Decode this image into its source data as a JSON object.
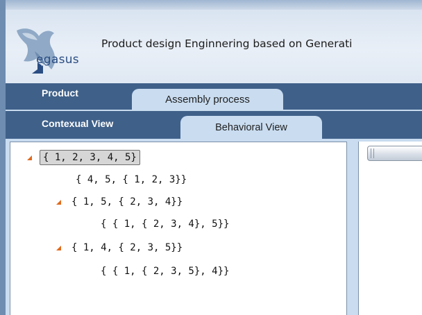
{
  "app": {
    "logo_text": "egasus",
    "title": "Product design Enginnering based on Generati"
  },
  "tabs_main": {
    "items": [
      {
        "label": "Product",
        "selected": false
      },
      {
        "label": "Assembly process",
        "selected": true
      }
    ]
  },
  "tabs_sub": {
    "items": [
      {
        "label": "Contexual View",
        "selected": false
      },
      {
        "label": "Behavioral View",
        "selected": true
      }
    ]
  },
  "tree": {
    "nodes": [
      {
        "label": "{ 1, 2, 3, 4, 5}",
        "expanded": true,
        "selected": true
      },
      {
        "label": "{ 4, 5, { 1, 2, 3}}"
      },
      {
        "label": "{ 1, 5, { 2, 3, 4}}",
        "expanded": true
      },
      {
        "label": "{ { 1, { 2, 3, 4}, 5}}"
      },
      {
        "label": "{ 1, 4, { 2, 3, 5}}",
        "expanded": true
      },
      {
        "label": "{ { 1, { 2, 3, 5}, 4}}"
      }
    ]
  },
  "colors": {
    "tab_bar": "#3f6089",
    "tab_selected": "#c9dcf0",
    "expander_arrow": "#e06a1c"
  }
}
